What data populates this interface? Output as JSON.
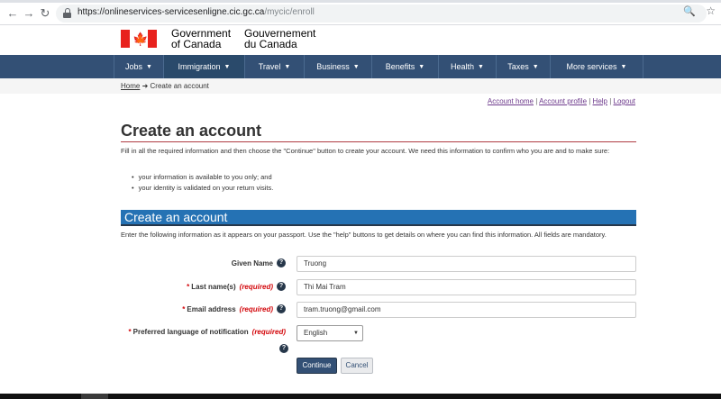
{
  "browser": {
    "url_host": "https://onlineservices-servicesenligne.cic.gc.ca",
    "url_path": "/mycic/enroll",
    "icons": [
      "back-icon",
      "forward-icon",
      "reload-icon",
      "lock-icon",
      "zoom-icon",
      "star-icon"
    ]
  },
  "header": {
    "signature_en_1": "Government",
    "signature_en_2": "of Canada",
    "signature_fr_1": "Gouvernement",
    "signature_fr_2": "du Canada",
    "flag_leaf": "🍁"
  },
  "menu": {
    "items": [
      {
        "label": "Jobs"
      },
      {
        "label": "Immigration"
      },
      {
        "label": "Travel"
      },
      {
        "label": "Business"
      },
      {
        "label": "Benefits"
      },
      {
        "label": "Health"
      },
      {
        "label": "Taxes"
      },
      {
        "label": "More services"
      }
    ],
    "active": "Immigration",
    "bar_color": "#335075"
  },
  "breadcrumb": {
    "home": "Home",
    "separator": "➜",
    "current": "Create an account"
  },
  "account_links": {
    "account_home": "Account home",
    "account_profile": "Account profile",
    "help": "Help",
    "logout": "Logout"
  },
  "page": {
    "title": "Create an account",
    "intro": "Fill in all the required information and then choose the \"Continue\" button to create your account. We need this information to confirm who you are and to make sure:",
    "bullets": [
      "your information is available to you only; and",
      "your identity is validated on your return visits."
    ],
    "section_title": "Create an account",
    "instructions": "Enter the following information as it appears on your passport. Use the \"help\" buttons to get details on where you can find this information. All fields are mandatory."
  },
  "form": {
    "required_text": "(required)",
    "given_name": {
      "label": "Given Name",
      "value": "Truong"
    },
    "last_name": {
      "label": "Last name(s)",
      "value": "Thi Mai Tram"
    },
    "email": {
      "label": "Email address",
      "value": "tram.truong@gmail.com"
    },
    "language": {
      "label": "Preferred language of notification",
      "value": "English"
    },
    "continue_label": "Continue",
    "cancel_label": "Cancel"
  }
}
